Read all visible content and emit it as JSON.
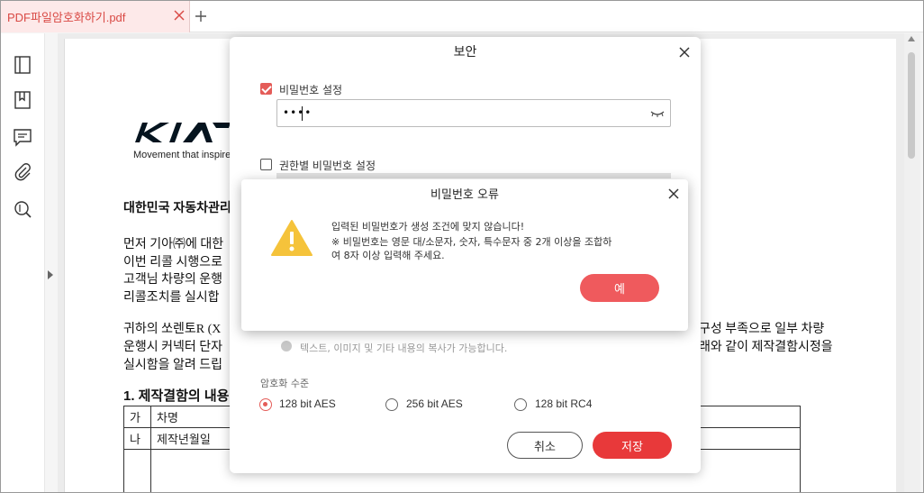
{
  "tab": {
    "title": "PDF파일암호화하기.pdf"
  },
  "document": {
    "tagline": "Movement that inspire",
    "lines": [
      "대한민국 자동차관리",
      "먼저 기아㈜에 대한",
      "이번 리콜 시행으로",
      "고객님 차량의 운행",
      "리콜조치를 실시합",
      "귀하의 쏘렌토R (X",
      "운행시 커넥터 단자",
      "실시함을 알려 드립",
      "1. 제작결함의 내용"
    ],
    "right_lines": [
      "구성 부족으로 일부 차량",
      "래와 같이 제작결함시정을"
    ],
    "table": [
      [
        "가",
        "차명"
      ],
      [
        "나",
        "제작년월일"
      ]
    ]
  },
  "security_dialog": {
    "title": "보안",
    "password_label": "비밀번호 설정",
    "password_value": "••••",
    "permission_label": "권한별 비밀번호 설정",
    "copy_note": "텍스트, 이미지 및 기타 내용의 복사가 가능합니다.",
    "encryption_label": "암호화 수준",
    "options": [
      "128 bit AES",
      "256 bit AES",
      "128 bit RC4"
    ],
    "cancel_label": "취소",
    "save_label": "저장"
  },
  "error_dialog": {
    "title": "비밀번호 오류",
    "message_line1": "입력된 비밀번호가 생성 조건에 맞지 않습니다!",
    "message_line2": "※ 비밀번호는 영문 대/소문자, 숫자, 특수문자 중 2개 이상을 조합하",
    "message_line3": "여 8자 이상 입력해 주세요.",
    "ok_label": "예"
  },
  "colors": {
    "accent": "#e8393a",
    "ok_button": "#ef5a5d",
    "warning": "#f5c33b",
    "tab_bg": "#fde9e9"
  }
}
